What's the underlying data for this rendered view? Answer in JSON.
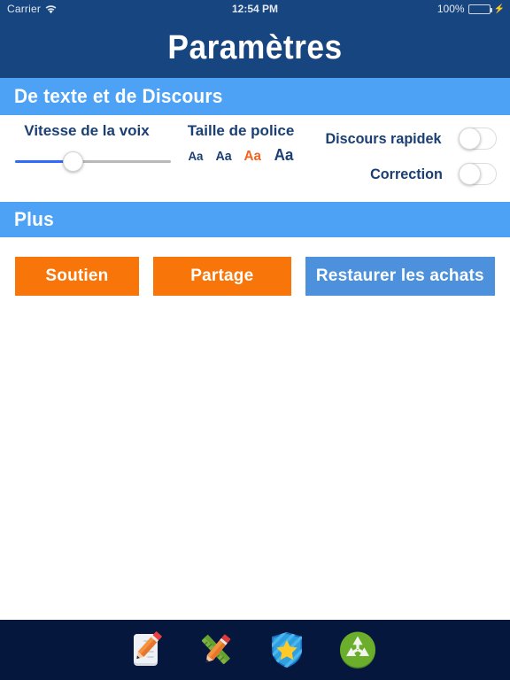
{
  "status_bar": {
    "carrier": "Carrier",
    "wifi_icon": "wifi-icon",
    "time": "12:54 PM",
    "battery_percent": "100%",
    "battery_icon": "battery-icon",
    "charging_icon": "lightning-bolt-icon",
    "battery_fill_color": "#4cd662"
  },
  "header": {
    "title": "Paramètres",
    "background_color": "#17457f",
    "text_color": "#ffffff"
  },
  "sections": {
    "text_and_speech": {
      "title": "De texte et de Discours",
      "bar_color": "#4da2f5"
    },
    "more": {
      "title": "Plus",
      "bar_color": "#4da2f5"
    }
  },
  "controls": {
    "voice_speed": {
      "label": "Vitesse de la voix",
      "value_percent": 36,
      "fill_color": "#2f6bff",
      "track_color": "#b8b8b8"
    },
    "font_size": {
      "label": "Taille de police",
      "options": [
        {
          "label": "Aa",
          "selected": false
        },
        {
          "label": "Aa",
          "selected": false
        },
        {
          "label": "Aa",
          "selected": true
        },
        {
          "label": "Aa",
          "selected": false
        }
      ],
      "selected_index": 2,
      "selected_color": "#f4641e",
      "unselected_color": "#1c3f73"
    },
    "toggles": [
      {
        "label": "Discours rapidek",
        "on": false
      },
      {
        "label": "Correction",
        "on": false
      }
    ],
    "label_color": "#1c3f73"
  },
  "actions": {
    "buttons": [
      {
        "label": "Soutien",
        "color": "#f87609"
      },
      {
        "label": "Partage",
        "color": "#f87609"
      },
      {
        "label": "Restaurer les achats",
        "color": "#4d91dd"
      }
    ]
  },
  "toolbar": {
    "background_color": "#06173d",
    "items": [
      {
        "icon": "memo-notepad-icon",
        "name": "notes"
      },
      {
        "icon": "pencil-and-ruler-icon",
        "name": "edit-tools"
      },
      {
        "icon": "shield-star-icon",
        "name": "favorites"
      },
      {
        "icon": "recycle-icon",
        "name": "recycle"
      }
    ]
  }
}
